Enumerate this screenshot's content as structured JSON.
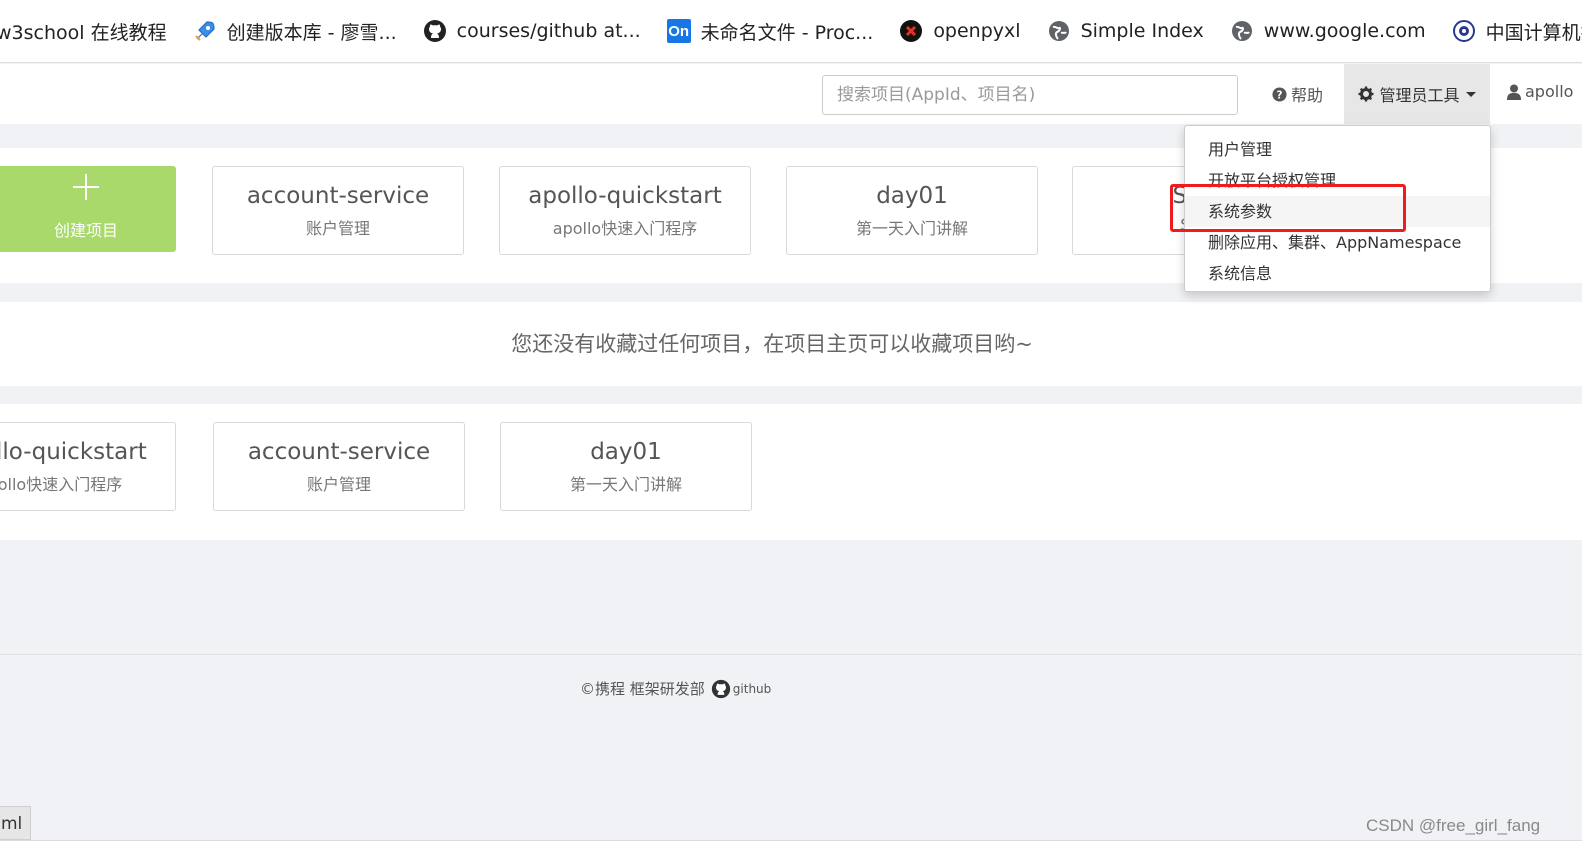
{
  "bookmarks": [
    {
      "label": "w3school 在线教程",
      "icon": "none"
    },
    {
      "label": "创建版本库 - 廖雪...",
      "icon": "rocket-icon"
    },
    {
      "label": "courses/github at...",
      "icon": "github-icon"
    },
    {
      "label": "未命名文件 - Proc...",
      "icon": "on-icon",
      "icon_text": "On"
    },
    {
      "label": "openpyxl",
      "icon": "x-icon"
    },
    {
      "label": "Simple Index",
      "icon": "globe-icon"
    },
    {
      "label": "www.google.com",
      "icon": "globe-icon"
    },
    {
      "label": "中国计算机技术职...",
      "icon": "seal-icon"
    }
  ],
  "navbar": {
    "search_placeholder": "搜索项目(AppId、项目名)",
    "help_label": "帮助",
    "admin_label": "管理员工具",
    "user_label": "apollo"
  },
  "admin_menu": {
    "items": [
      "用户管理",
      "开放平台授权管理",
      "系统参数",
      "删除应用、集群、AppNamespace",
      "系统信息"
    ],
    "highlighted": "系统参数"
  },
  "my_projects": {
    "create_label": "创建项目",
    "cards": [
      {
        "name": "account-service",
        "desc": "账户管理"
      },
      {
        "name": "apollo-quickstart",
        "desc": "apollo快速入门程序"
      },
      {
        "name": "day01",
        "desc": "第一天入门讲解"
      },
      {
        "name": "Sam",
        "desc": "Sam"
      }
    ]
  },
  "favorites": {
    "empty_message": "您还没有收藏过任何项目，在项目主页可以收藏项目哟~"
  },
  "recent": {
    "cards": [
      {
        "name": "apollo-quickstart",
        "desc": "apollo快速入门程序"
      },
      {
        "name": "account-service",
        "desc": "账户管理"
      },
      {
        "name": "day01",
        "desc": "第一天入门讲解"
      }
    ]
  },
  "footer": {
    "copyright": "©携程 框架研发部",
    "github_label": "github"
  },
  "bottom_tab_label": "ml",
  "watermark": "CSDN @free_girl_fang",
  "colors": {
    "accent_green": "#a8d96a",
    "highlight_red": "#ee1c1c",
    "admin_active_bg": "#e7e7e7"
  }
}
